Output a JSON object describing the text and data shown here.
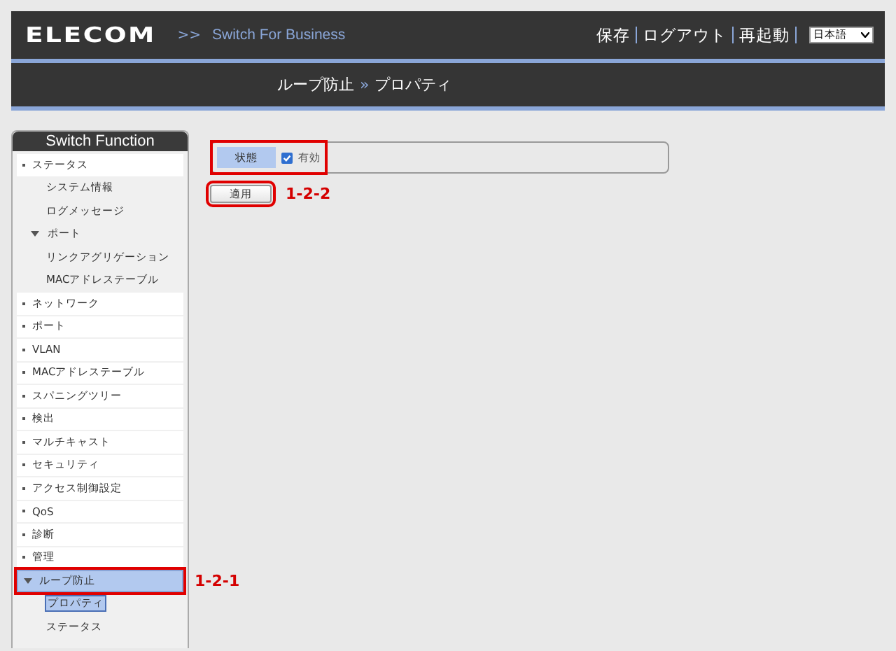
{
  "header": {
    "logo": "ELECOM",
    "crumb_mark": ">>",
    "product": "Switch For Business",
    "links": [
      "保存",
      "ログアウト",
      "再起動"
    ],
    "language": "日本語"
  },
  "breadcrumb": {
    "section": "ループ防止",
    "separator": "»",
    "page": "プロパティ"
  },
  "sidebar": {
    "title": "Switch Function",
    "items": [
      {
        "label": "ステータス",
        "kind": "dot",
        "selected": false,
        "children": [
          {
            "label": "システム情報",
            "selected": false
          },
          {
            "label": "ログメッセージ",
            "selected": false
          },
          {
            "label": "ポート",
            "kind": "triangle",
            "selected": false,
            "children": [
              {
                "label": "リンクアグリゲーション",
                "selected": false
              },
              {
                "label": "MACアドレステーブル",
                "selected": false
              }
            ]
          }
        ]
      },
      {
        "label": "ネットワーク",
        "kind": "dot",
        "selected": false
      },
      {
        "label": "ポート",
        "kind": "dot",
        "selected": false
      },
      {
        "label": "VLAN",
        "kind": "dot",
        "selected": false
      },
      {
        "label": "MACアドレステーブル",
        "kind": "dot",
        "selected": false
      },
      {
        "label": "スパニングツリー",
        "kind": "dot",
        "selected": false
      },
      {
        "label": "検出",
        "kind": "dot",
        "selected": false
      },
      {
        "label": "マルチキャスト",
        "kind": "dot",
        "selected": false
      },
      {
        "label": "セキュリティ",
        "kind": "dot",
        "selected": false
      },
      {
        "label": "アクセス制御設定",
        "kind": "dot",
        "selected": false
      },
      {
        "label": "QoS",
        "kind": "dot",
        "selected": false
      },
      {
        "label": "診断",
        "kind": "dot",
        "selected": false
      },
      {
        "label": "管理",
        "kind": "dot",
        "selected": false
      },
      {
        "label": "ループ防止",
        "kind": "triangle",
        "selected": true,
        "annotation": "1-2-1",
        "children": [
          {
            "label": "プロパティ",
            "selected": true
          },
          {
            "label": "ステータス",
            "selected": false
          }
        ]
      }
    ]
  },
  "panel": {
    "field_label": "状態",
    "checkbox": {
      "label": "有効",
      "checked": true
    },
    "apply_button": "適用",
    "annotation": "1-2-2"
  }
}
